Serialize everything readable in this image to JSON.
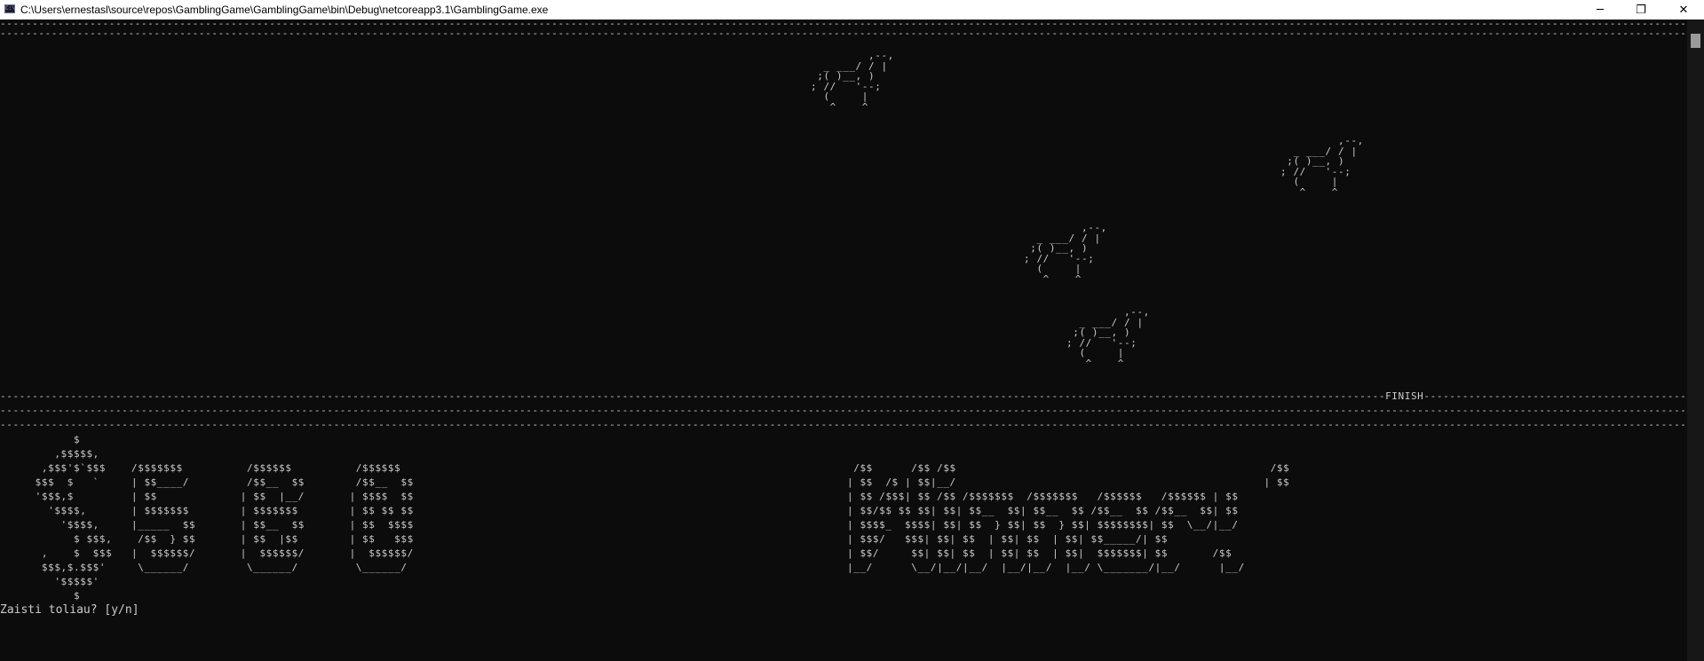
{
  "window": {
    "title": "C:\\Users\\ernestasl\\source\\repos\\GamblingGame\\GamblingGame\\bin\\Debug\\netcoreapp3.1\\GamblingGame.exe",
    "icon_label": "C:\\",
    "minimize_glyph": "─",
    "maximize_glyph": "❐",
    "close_glyph": "✕"
  },
  "track": {
    "top_border_1": "----------------------------------------------------------------------------------------------------------------------------------------------------------------------------------------------------------------------------------------------------------------------------------",
    "top_border_2": "----------------------------------------------------------------------------------------------------------------------------------------------------------------------------------------------------------------------------------------------------------------------------------",
    "finish_line": "------------------------------------------------------------------------------------------------------------------------------------------------------------------------------------------------------------------------FINISH-----------------------------------------------------",
    "bottom_border_1": "----------------------------------------------------------------------------------------------------------------------------------------------------------------------------------------------------------------------------------------------------------------------------------",
    "bottom_border_2": "----------------------------------------------------------------------------------------------------------------------------------------------------------------------------------------------------------------------------------------------------------------------------------"
  },
  "horses": [
    {
      "art": "         ,--,\n  _ ___/ / |\n ;( )__, )\n; //   '--;\n  (     |\n   ^    ^"
    },
    {
      "art": "         ,--,\n  _ ___/ / |\n ;( )__, )\n; //   '--;\n  (     |\n   ^    ^"
    },
    {
      "art": "         ,--,\n  _ ___/ / |\n ;( )__, )\n; //   '--;\n  (     |\n   ^    ^"
    },
    {
      "art": "         ,--,\n  _ ___/ / |\n ;( )__, )\n; //   '--;\n  (     |\n   ^    ^"
    }
  ],
  "result": {
    "bet_banner": "         $\n      ,$$$$$,\n    ,$$$'$`$$$    /$$$$$$$          /$$$$$$          /$$$$$$\n   $$$  $   `     | $$____/         /$$__  $$        /$$__  $$\n   '$$$,$         | $$             | $$  |__/       | $$$$  $$\n     '$$$$,       | $$$$$$$        | $$$$$$$        | $$ $$ $$\n       '$$$$,     |_____  $$       | $$__  $$       | $$  $$$$\n         $ $$$,    /$$  } $$       | $$  |$$        | $$   $$$\n    ,    $  $$$   |  $$$$$$/       |  $$$$$$/       |  $$$$$$/\n    $$$,$.$$$'     \\______/         \\______/         \\______/\n      '$$$$$'\n         $",
    "win_banner": " /$$      /$$ /$$                                                 /$$\n| $$  /$ | $$|__/                                                | $$\n| $$ /$$$| $$ /$$ /$$$$$$$  /$$$$$$$   /$$$$$$   /$$$$$$ | $$\n| $$/$$ $$ $$| $$| $$__  $$| $$__  $$ /$$__  $$ /$$__  $$| $$\n| $$$$_  $$$$| $$| $$  } $$| $$  } $$| $$$$$$$$| $$  \\__/|__/\n| $$$/   $$$| $$| $$  | $$| $$  | $$| $$_____/| $$\n| $$/     $$| $$| $$  | $$| $$  | $$|  $$$$$$$| $$       /$$\n|__/      \\__/|__/|__/  |__/|__/  |__/ \\_______/|__/      |__/"
  },
  "prompt": {
    "text": "Zaisti toliau? [y/n]"
  }
}
